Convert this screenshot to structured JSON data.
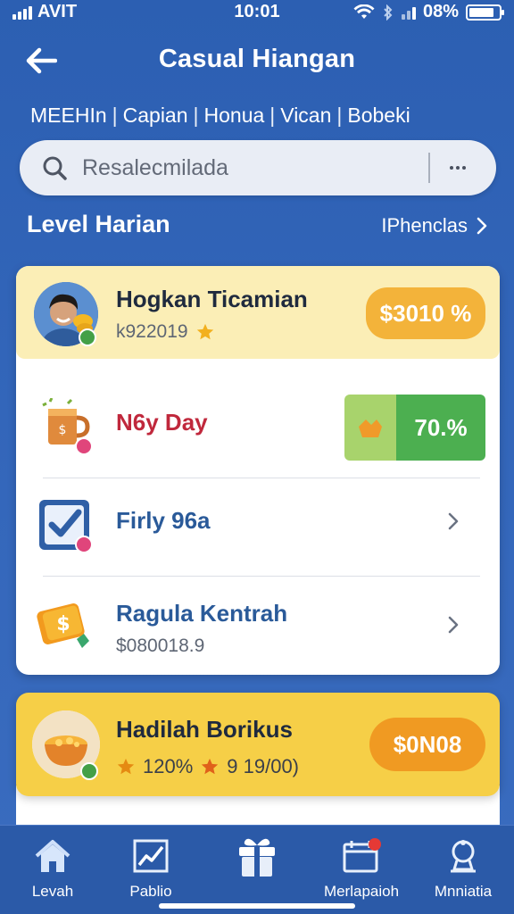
{
  "status_bar": {
    "carrier": "AVIT",
    "time": "10:01",
    "battery": "08%",
    "battery_level": 0.85
  },
  "header": {
    "title": "Casual Hiangan"
  },
  "filters": [
    "MEEHIn",
    "Capian",
    "Honua",
    "Vican",
    "Bobeki"
  ],
  "search": {
    "placeholder": "Resalecmilada"
  },
  "section": {
    "title": "Level Harian",
    "see_all": "IPhenclas"
  },
  "rows": [
    {
      "title": "Hogkan Ticamian",
      "subtitle": "k922019",
      "pill": "$3010 %"
    },
    {
      "title": "N6y Day",
      "pill": "70.%"
    },
    {
      "title": "Firly 96a"
    },
    {
      "title": "Ragula Kentrah",
      "subtitle": "$080018.9"
    }
  ],
  "bonus": {
    "title": "Hadilah Borikus",
    "stat_1": "120%",
    "stat_2": "9 19/00)",
    "pill": "$0N08"
  },
  "bottom_nav": [
    {
      "label": "Levah",
      "icon": "home-icon"
    },
    {
      "label": "Pablio",
      "icon": "chart-icon"
    },
    {
      "label": "",
      "icon": "gift-icon"
    },
    {
      "label": "Merlapaioh",
      "icon": "calendar-icon"
    },
    {
      "label": "Mnniatia",
      "icon": "trophy-icon"
    }
  ],
  "colors": {
    "background": "#2f63b6",
    "highlight_row": "#fbeeb6",
    "pill_orange": "#f3b33a",
    "pill_green": "#4caf50",
    "bonus_card": "#f6cf47",
    "title_red": "#c0283c",
    "title_blue": "#2a5a99"
  }
}
